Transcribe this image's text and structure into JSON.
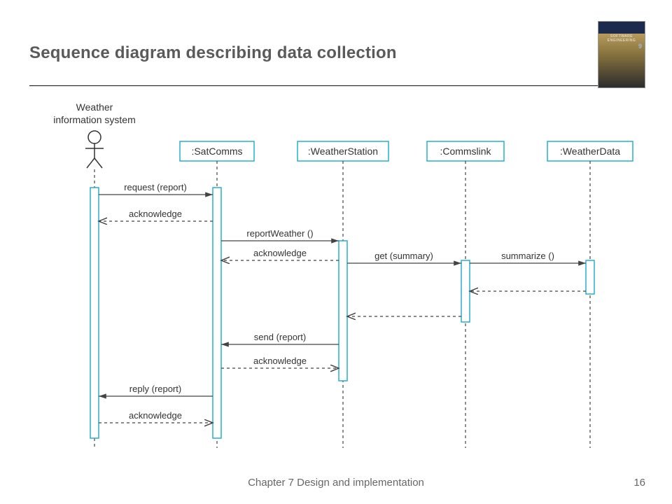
{
  "title": "Sequence diagram describing data collection",
  "footer": "Chapter 7 Design and implementation",
  "page": "16",
  "actor": {
    "label1": "Weather",
    "label2": "information system"
  },
  "lifelines": {
    "sat": ":SatComms",
    "ws": ":WeatherStation",
    "cl": ":Commslink",
    "wd": ":WeatherData"
  },
  "messages": {
    "m1": "request (report)",
    "m2": "acknowledge",
    "m3": "reportWeather ()",
    "m4": "acknowledge",
    "m5": "get (summary)",
    "m6": "summarize ()",
    "m7": "",
    "m8": "",
    "m9": "send (report)",
    "m10": "acknowledge",
    "m11": "reply (report)",
    "m12": "acknowledge"
  }
}
